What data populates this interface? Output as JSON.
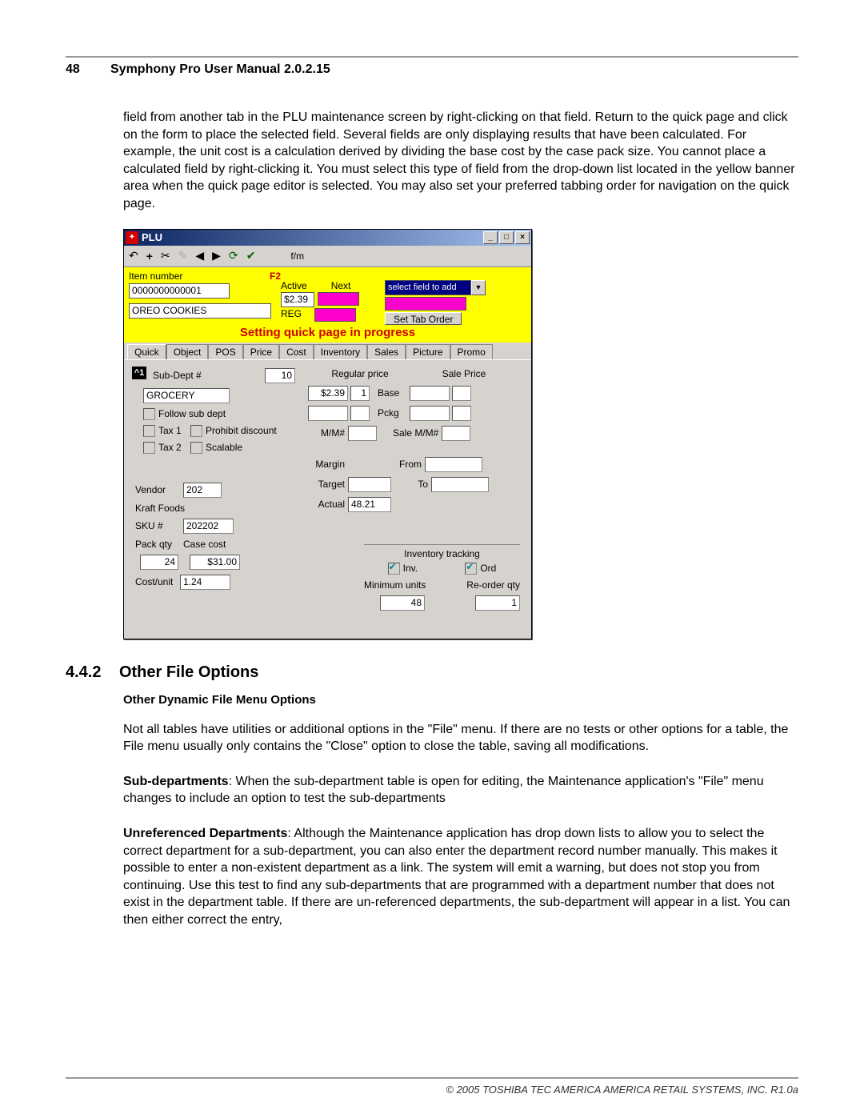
{
  "page_number": "48",
  "manual_title": "Symphony Pro User Manual  2.0.2.15",
  "intro_paragraph": "field from another tab in the PLU maintenance screen by right-clicking on that field. Return to the quick page and click on the form to place the selected field. Several fields are only displaying results that have been calculated. For example, the unit cost is a calculation derived by dividing the base cost by the case pack size. You cannot place a calculated field by right-clicking it. You must select this type of field from the drop-down list located in the yellow banner area when the quick page editor is selected. You may also set your preferred tabbing order for navigation on the quick page.",
  "window": {
    "title": "PLU",
    "toolbar_fm": "f/m",
    "yellow": {
      "item_number_label": "Item number",
      "f2": "F2",
      "item_number_value": "0000000000001",
      "description_value": "OREO COOKIES",
      "active_label": "Active",
      "price_value": "$2.39",
      "reg_label": "REG",
      "next_label": "Next",
      "select_field": "select field to add",
      "set_tab_order": "Set Tab Order",
      "setting_msg": "Setting quick page in progress"
    },
    "tabs": [
      "Quick",
      "Object",
      "POS",
      "Price",
      "Cost",
      "Inventory",
      "Sales",
      "Picture",
      "Promo"
    ],
    "form": {
      "chip": "^1",
      "subdept_label": "Sub-Dept #",
      "subdept_value": "10",
      "subdept_name": "GROCERY",
      "follow_sub": "Follow sub dept",
      "tax1": "Tax 1",
      "prohibit": "Prohibit discount",
      "tax2": "Tax 2",
      "scalable": "Scalable",
      "vendor_label": "Vendor",
      "vendor_value": "202",
      "vendor_name": "Kraft Foods",
      "sku_label": "SKU #",
      "sku_value": "202202",
      "packqty_label": "Pack qty",
      "packqty_value": "24",
      "casecost_label": "Case cost",
      "casecost_value": "$31.00",
      "costunit_label": "Cost/unit",
      "costunit_value": "1.24",
      "regular_price_label": "Regular price",
      "sale_price_label": "Sale Price",
      "base_label": "Base",
      "base_price": "$2.39",
      "base_qty": "1",
      "pckg_label": "Pckg",
      "mm_label": "M/M#",
      "sale_mm_label": "Sale M/M#",
      "margin_label": "Margin",
      "from_label": "From",
      "target_label": "Target",
      "to_label": "To",
      "actual_label": "Actual",
      "actual_value": "48.21",
      "inv_title": "Inventory tracking",
      "inv_label": "Inv.",
      "ord_label": "Ord",
      "min_units_label": "Minimum units",
      "min_units_value": "48",
      "reorder_label": "Re-order qty",
      "reorder_value": "1"
    }
  },
  "section": {
    "number": "4.4.2",
    "title": "Other File Options",
    "subtitle": "Other Dynamic File Menu Options",
    "p1": " Not all tables have utilities or additional options in the \"File\" menu. If there are no tests or other options for a table, the File menu usually only contains the \"Close\" option to close the table, saving all modifications.",
    "p2a": "Sub-departments",
    "p2b": ": When the sub-department table is open for editing, the Maintenance application's \"File\" menu changes to include an option to test the sub-departments",
    "p3a": "Unreferenced Departments",
    "p3b": ": Although the Maintenance application has drop down lists to allow you to select the correct department for a sub-department, you can also enter the department record number manually. This makes it possible to enter a non-existent department as a link. The system will emit a warning, but does not stop you from continuing. Use this test to find any sub-departments that are programmed with a department number that does not exist in the department table. If there are un-referenced departments, the sub-department will appear in a list. You can then either correct the entry,"
  },
  "footer": "© 2005 TOSHIBA TEC AMERICA AMERICA RETAIL SYSTEMS, INC.   R1.0a"
}
